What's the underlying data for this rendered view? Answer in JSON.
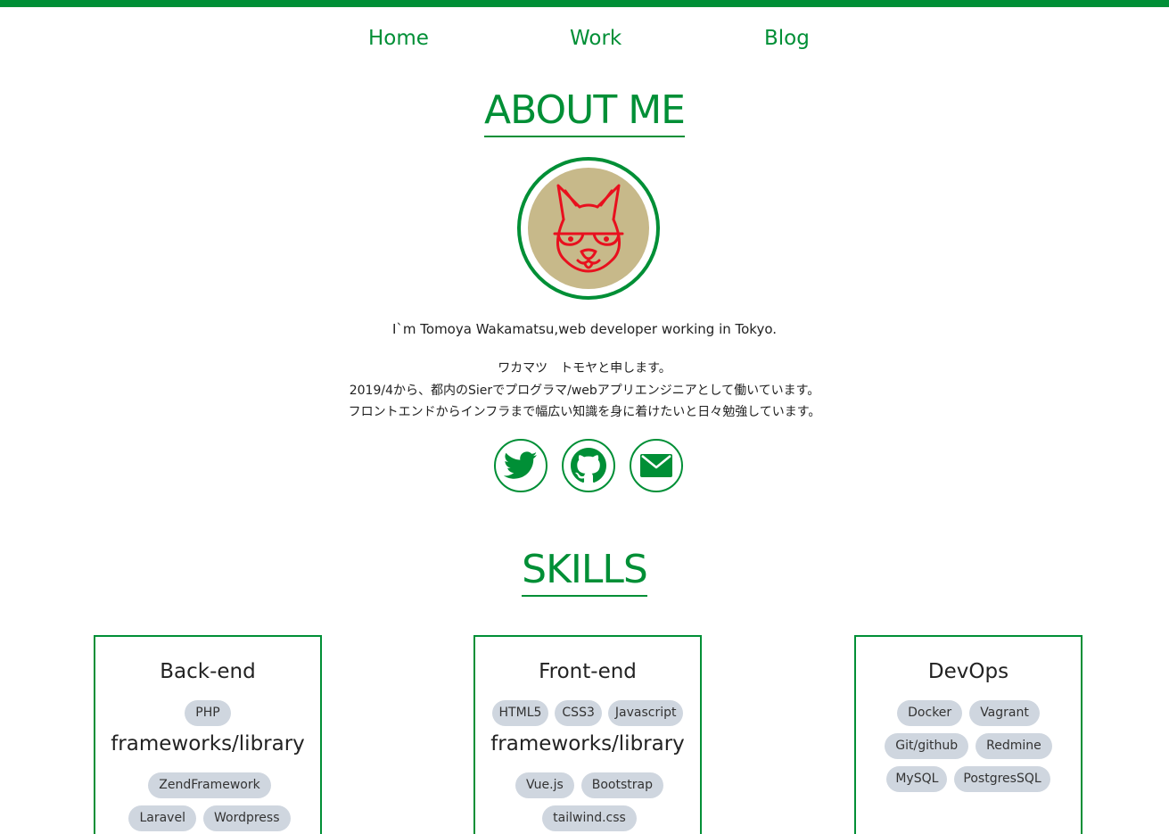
{
  "colors": {
    "accent": "#008f36",
    "avatar_bg": "#c7b98a",
    "tag_bg": "#cfd6df",
    "avatar_line": "#e8101e"
  },
  "nav": {
    "items": [
      "Home",
      "Work",
      "Blog"
    ]
  },
  "about": {
    "title": "ABOUT ME",
    "intro": "I`m Tomoya Wakamatsu,web developer working in Tokyo.",
    "jp_lines": [
      "ワカマツ　トモヤと申します。",
      "2019/4から、都内のSierでプログラマ/webアプリエンジニアとして働いています。",
      "フロントエンドからインフラまで幅広い知識を身に着けたいと日々勉強しています。"
    ],
    "social": [
      "twitter-icon",
      "github-icon",
      "mail-icon"
    ]
  },
  "skills": {
    "title": "SKILLS",
    "cards": [
      {
        "title": "Back-end",
        "languages": [
          "PHP"
        ],
        "sub_title": "frameworks/library",
        "frameworks": [
          "ZendFramework",
          "Laravel",
          "Wordpress"
        ]
      },
      {
        "title": "Front-end",
        "languages": [
          "HTML5",
          "CSS3",
          "Javascript"
        ],
        "sub_title": "frameworks/library",
        "frameworks": [
          "Vue.js",
          "Bootstrap",
          "tailwind.css"
        ]
      },
      {
        "title": "DevOps",
        "tags": [
          "Docker",
          "Vagrant",
          "Git/github",
          "Redmine",
          "MySQL",
          "PostgresSQL"
        ]
      }
    ]
  }
}
